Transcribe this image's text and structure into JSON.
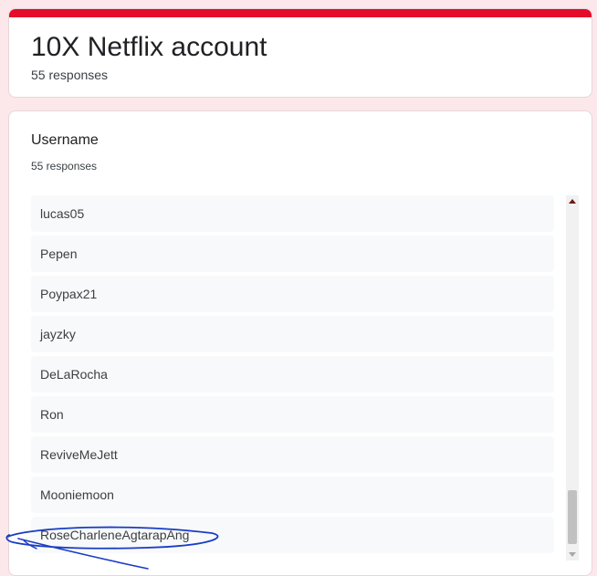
{
  "header": {
    "title": "10X Netflix account",
    "responses": "55 responses"
  },
  "question": {
    "title": "Username",
    "responses": "55 responses",
    "items": [
      "lucas05",
      "Pepen",
      "Poypax21",
      "jayzky",
      "DeLaRocha",
      "Ron",
      "ReviveMeJett",
      "Mooniemoon",
      "RoseCharleneAgtarapAng"
    ]
  },
  "colors": {
    "accent": "#e40b2b",
    "background": "#fce8ea",
    "annotation": "#1a3cc4"
  },
  "icons": {
    "scroll_up": "arrow-up-icon",
    "scroll_down": "arrow-down-icon"
  }
}
